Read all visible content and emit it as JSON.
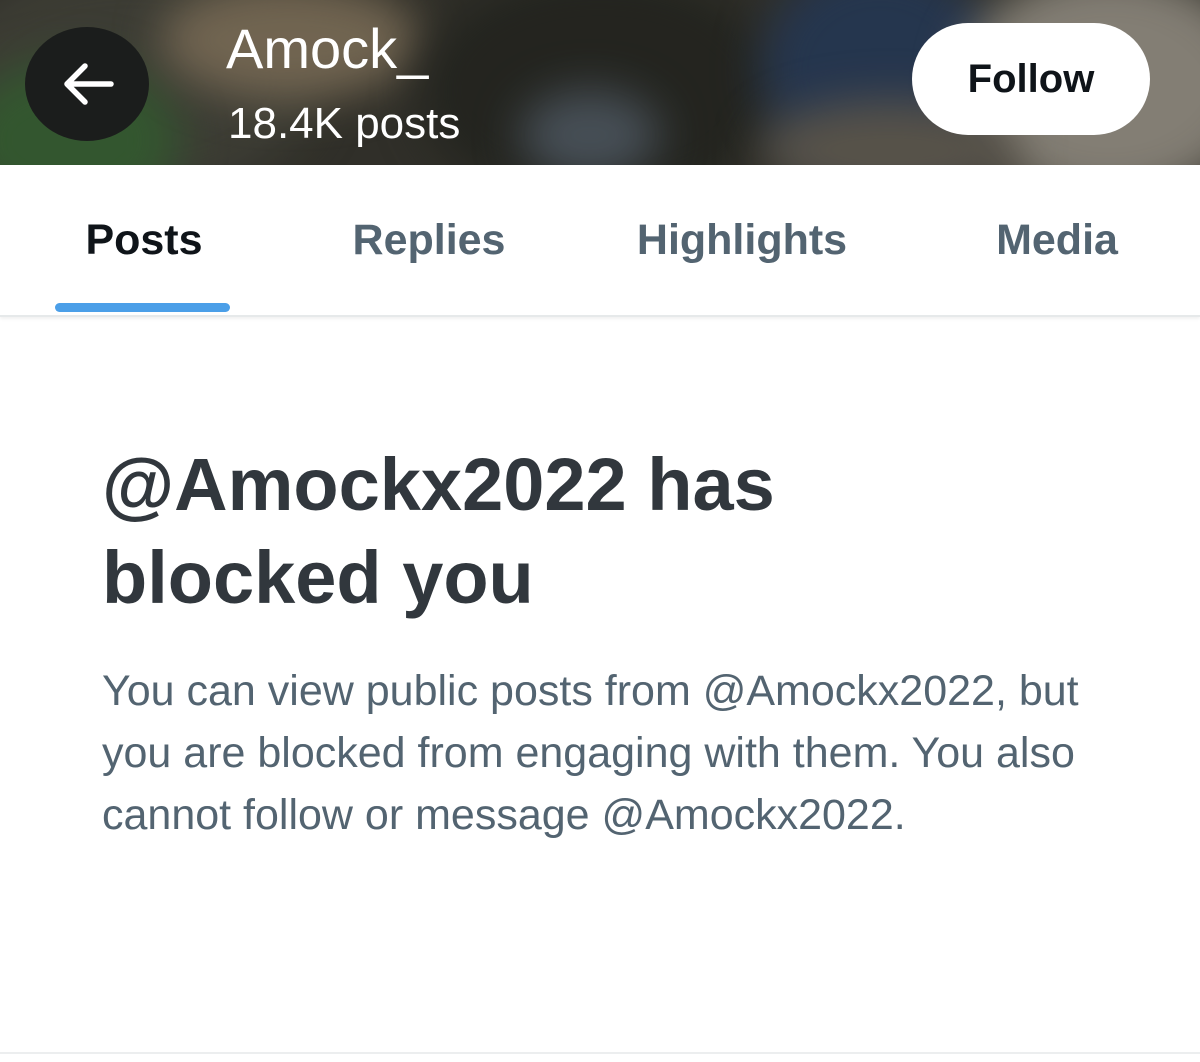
{
  "header": {
    "back_icon": "arrow-left-icon",
    "profile_name": "Amock_",
    "post_count": "18.4K posts",
    "follow_label": "Follow"
  },
  "tabs": [
    {
      "label": "Posts",
      "active": true
    },
    {
      "label": "Replies",
      "active": false
    },
    {
      "label": "Highlights",
      "active": false
    },
    {
      "label": "Media",
      "active": false
    }
  ],
  "blocked": {
    "title": "@Amockx2022 has blocked you",
    "body": "You can view public posts from @Amockx2022, but you are blocked from engaging with them. You also cannot follow or message @Amockx2022."
  },
  "colors": {
    "accent": "#4b9fe8",
    "text_primary": "#0f1419",
    "text_secondary": "#536471",
    "title_text": "#31373d"
  }
}
